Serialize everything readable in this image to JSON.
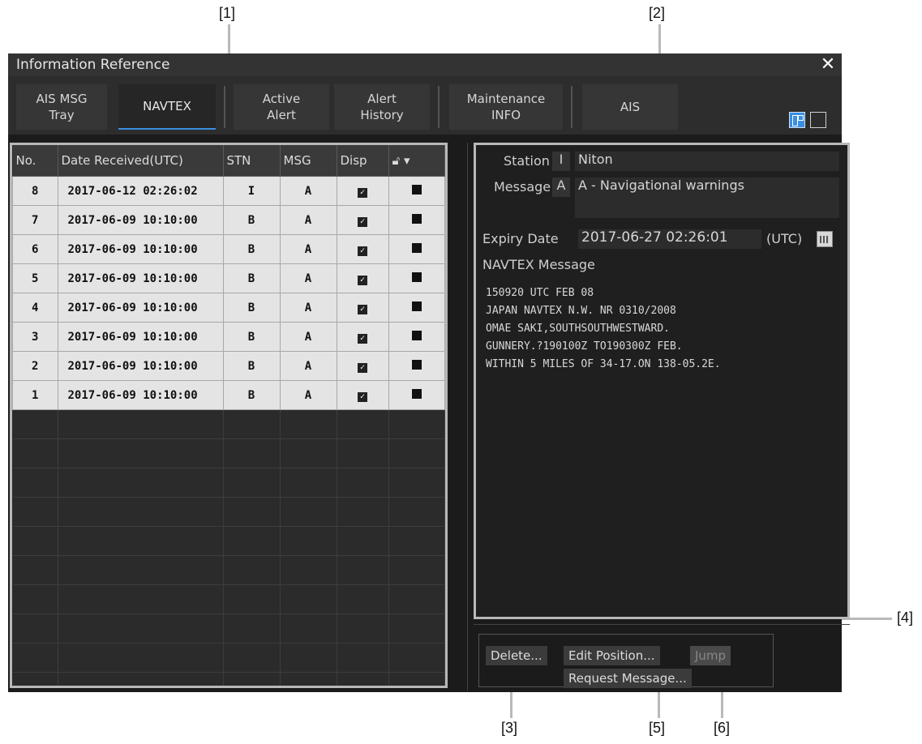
{
  "callouts": [
    "[1]",
    "[2]",
    "[3]",
    "[4]",
    "[5]",
    "[6]"
  ],
  "window": {
    "title": "Information Reference"
  },
  "tabs": [
    {
      "label": "AIS MSG\nTray"
    },
    {
      "label": "NAVTEX"
    },
    {
      "label": "Active\nAlert"
    },
    {
      "label": "Alert\nHistory"
    },
    {
      "label": "Maintenance\nINFO"
    },
    {
      "label": "AIS"
    }
  ],
  "list": {
    "headers": [
      "No.",
      "Date Received(UTC)",
      "STN",
      "MSG",
      "Disp",
      "▾"
    ],
    "rows": [
      {
        "no": "8",
        "date": "2017-06-12 02:26:02",
        "stn": "I",
        "msg": "A",
        "disp": true
      },
      {
        "no": "7",
        "date": "2017-06-09 10:10:00",
        "stn": "B",
        "msg": "A",
        "disp": true
      },
      {
        "no": "6",
        "date": "2017-06-09 10:10:00",
        "stn": "B",
        "msg": "A",
        "disp": true
      },
      {
        "no": "5",
        "date": "2017-06-09 10:10:00",
        "stn": "B",
        "msg": "A",
        "disp": true
      },
      {
        "no": "4",
        "date": "2017-06-09 10:10:00",
        "stn": "B",
        "msg": "A",
        "disp": true
      },
      {
        "no": "3",
        "date": "2017-06-09 10:10:00",
        "stn": "B",
        "msg": "A",
        "disp": true
      },
      {
        "no": "2",
        "date": "2017-06-09 10:10:00",
        "stn": "B",
        "msg": "A",
        "disp": true
      },
      {
        "no": "1",
        "date": "2017-06-09 10:10:00",
        "stn": "B",
        "msg": "A",
        "disp": true
      }
    ]
  },
  "detail": {
    "station_label": "Station",
    "station_code": "I",
    "station_value": "Niton",
    "message_label": "Message",
    "message_code": "A",
    "message_value": "A - Navigational warnings",
    "expiry_label": "Expiry Date",
    "expiry_value": "2017-06-27 02:26:01",
    "expiry_unit": "(UTC)",
    "navtex_label": "NAVTEX Message",
    "navtex_lines": [
      "150920 UTC FEB 08",
      "JAPAN NAVTEX N.W. NR 0310/2008",
      "OMAE SAKI,SOUTHSOUTHWESTWARD.",
      "GUNNERY.?190100Z TO190300Z FEB.",
      "WITHIN 5 MILES OF 34-17.ON 138-05.2E."
    ]
  },
  "buttons": {
    "delete": "Delete...",
    "edit_position": "Edit Position...",
    "jump": "Jump",
    "request_message": "Request Message..."
  }
}
